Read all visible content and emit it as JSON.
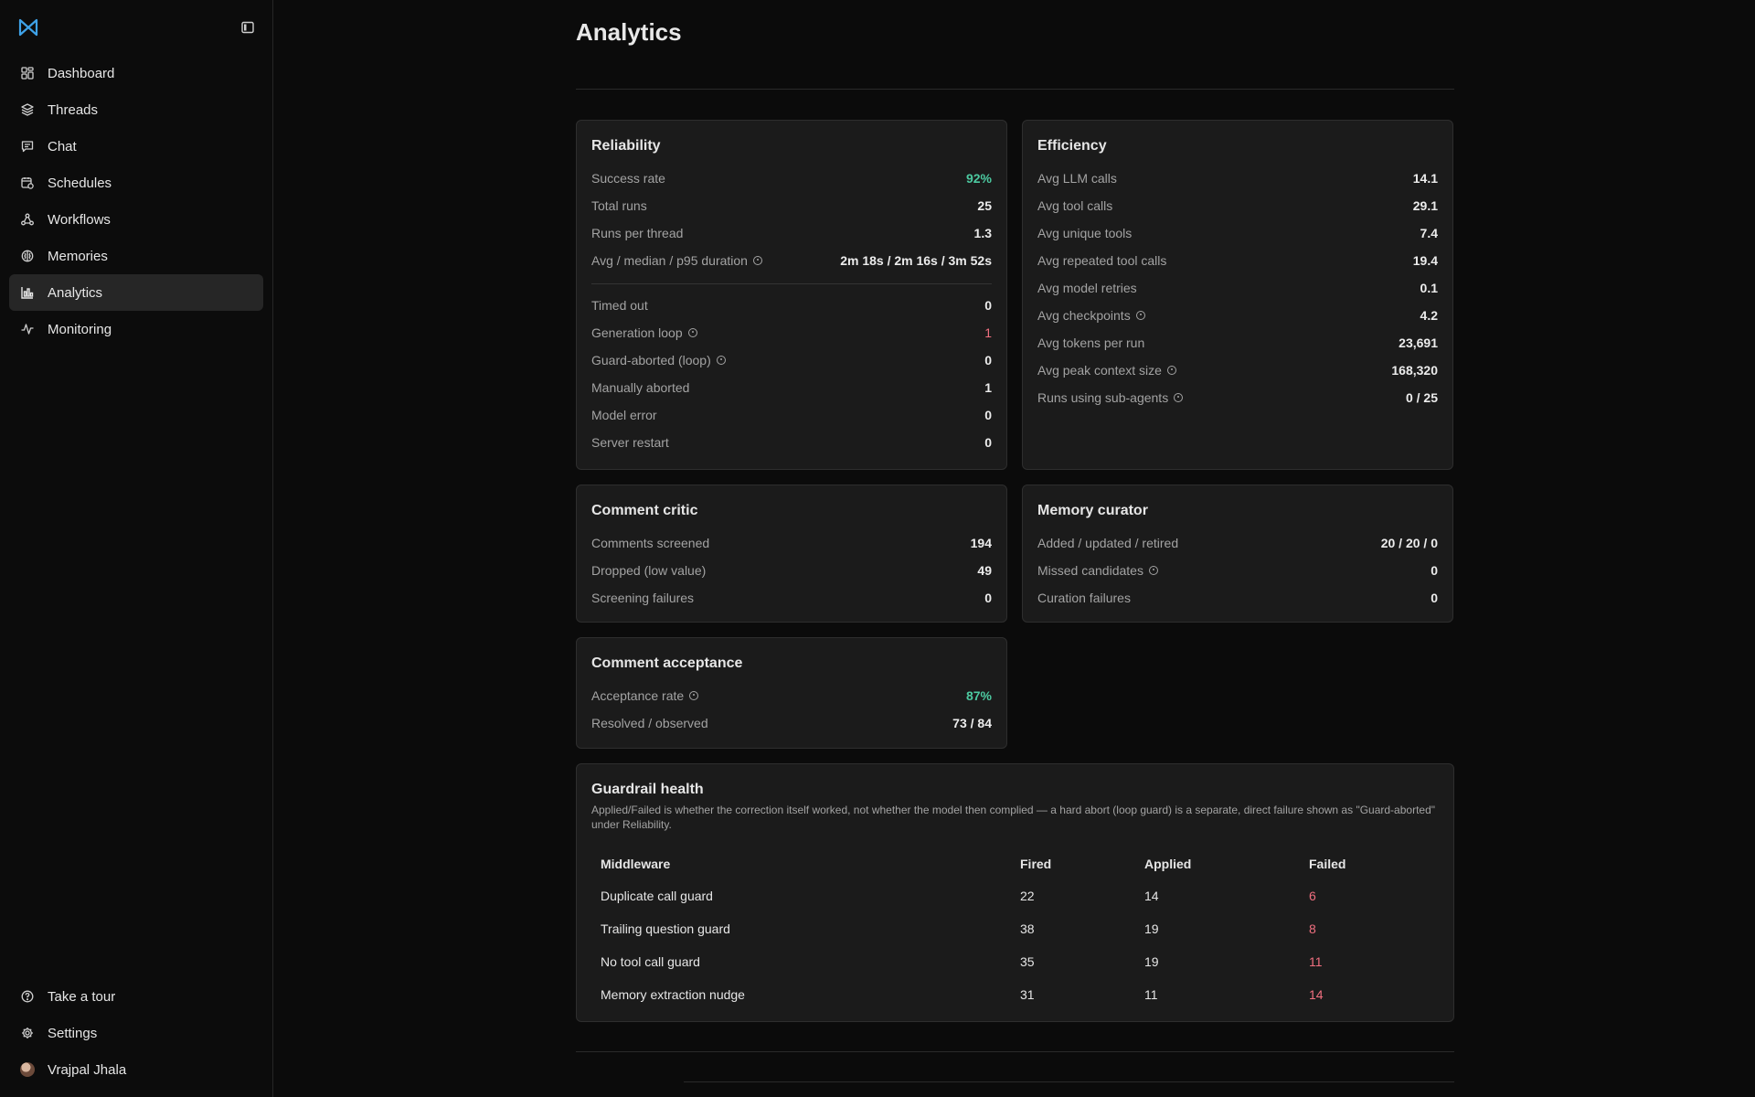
{
  "sidebar": {
    "logo_icon": "mesh-logo-icon",
    "collapse_icon": "panel-toggle-icon",
    "items": [
      {
        "label": "Dashboard",
        "icon": "grid-icon"
      },
      {
        "label": "Threads",
        "icon": "layers-icon"
      },
      {
        "label": "Chat",
        "icon": "message-icon"
      },
      {
        "label": "Schedules",
        "icon": "calendar-clock-icon"
      },
      {
        "label": "Workflows",
        "icon": "workflow-icon"
      },
      {
        "label": "Memories",
        "icon": "brain-icon"
      },
      {
        "label": "Analytics",
        "icon": "bar-chart-icon",
        "active": true
      },
      {
        "label": "Monitoring",
        "icon": "activity-icon"
      }
    ],
    "bottom": [
      {
        "label": "Take a tour",
        "icon": "help-circle-icon"
      },
      {
        "label": "Settings",
        "icon": "gear-icon"
      },
      {
        "label": "Vrajpal Jhala",
        "icon": "avatar"
      }
    ]
  },
  "page": {
    "title": "Analytics"
  },
  "colors": {
    "accent_green": "#4cc9a0",
    "accent_red": "#f06f7f",
    "card_bg": "#1b1b1b",
    "logo_blue": "#3ea2e8"
  },
  "reliability": {
    "title": "Reliability",
    "rows": [
      {
        "label": "Success rate",
        "value": "92%"
      },
      {
        "label": "Total runs",
        "value": "25"
      },
      {
        "label": "Runs per thread",
        "value": "1.3"
      },
      {
        "label": "Avg / median / p95 duration",
        "value": "2m 18s / 2m 16s / 3m 52s"
      }
    ],
    "failures": [
      {
        "label": "Timed out",
        "value": "0"
      },
      {
        "label": "Generation loop",
        "value": "1"
      },
      {
        "label": "Guard-aborted (loop)",
        "value": "0"
      },
      {
        "label": "Manually aborted",
        "value": "1"
      },
      {
        "label": "Model error",
        "value": "0"
      },
      {
        "label": "Server restart",
        "value": "0"
      }
    ]
  },
  "efficiency": {
    "title": "Efficiency",
    "rows": [
      {
        "label": "Avg LLM calls",
        "value": "14.1"
      },
      {
        "label": "Avg tool calls",
        "value": "29.1"
      },
      {
        "label": "Avg unique tools",
        "value": "7.4"
      },
      {
        "label": "Avg repeated tool calls",
        "value": "19.4"
      },
      {
        "label": "Avg model retries",
        "value": "0.1"
      },
      {
        "label": "Avg checkpoints",
        "value": "4.2"
      },
      {
        "label": "Avg tokens per run",
        "value": "23,691"
      },
      {
        "label": "Avg peak context size",
        "value": "168,320"
      },
      {
        "label": "Runs using sub-agents",
        "value": "0 / 25"
      }
    ]
  },
  "comment_critic": {
    "title": "Comment critic",
    "rows": [
      {
        "label": "Comments screened",
        "value": "194"
      },
      {
        "label": "Dropped (low value)",
        "value": "49"
      },
      {
        "label": "Screening failures",
        "value": "0"
      }
    ]
  },
  "memory_curator": {
    "title": "Memory curator",
    "rows": [
      {
        "label": "Added / updated / retired",
        "value": "20 / 20 / 0"
      },
      {
        "label": "Missed candidates",
        "value": "0"
      },
      {
        "label": "Curation failures",
        "value": "0"
      }
    ]
  },
  "comment_acceptance": {
    "title": "Comment acceptance",
    "rows": [
      {
        "label": "Acceptance rate",
        "value": "87%"
      },
      {
        "label": "Resolved / observed",
        "value": "73 / 84"
      }
    ]
  },
  "guardrail": {
    "title": "Guardrail health",
    "description": "Applied/Failed is whether the correction itself worked, not whether the model then complied — a hard abort (loop guard) is a separate, direct failure shown as \"Guard-aborted\" under Reliability.",
    "columns": [
      "Middleware",
      "Fired",
      "Applied",
      "Failed"
    ],
    "rows": [
      {
        "middleware": "Duplicate call guard",
        "fired": "22",
        "applied": "14",
        "failed": "6"
      },
      {
        "middleware": "Trailing question guard",
        "fired": "38",
        "applied": "19",
        "failed": "8"
      },
      {
        "middleware": "No tool call guard",
        "fired": "35",
        "applied": "19",
        "failed": "11"
      },
      {
        "middleware": "Memory extraction nudge",
        "fired": "31",
        "applied": "11",
        "failed": "14"
      }
    ]
  }
}
